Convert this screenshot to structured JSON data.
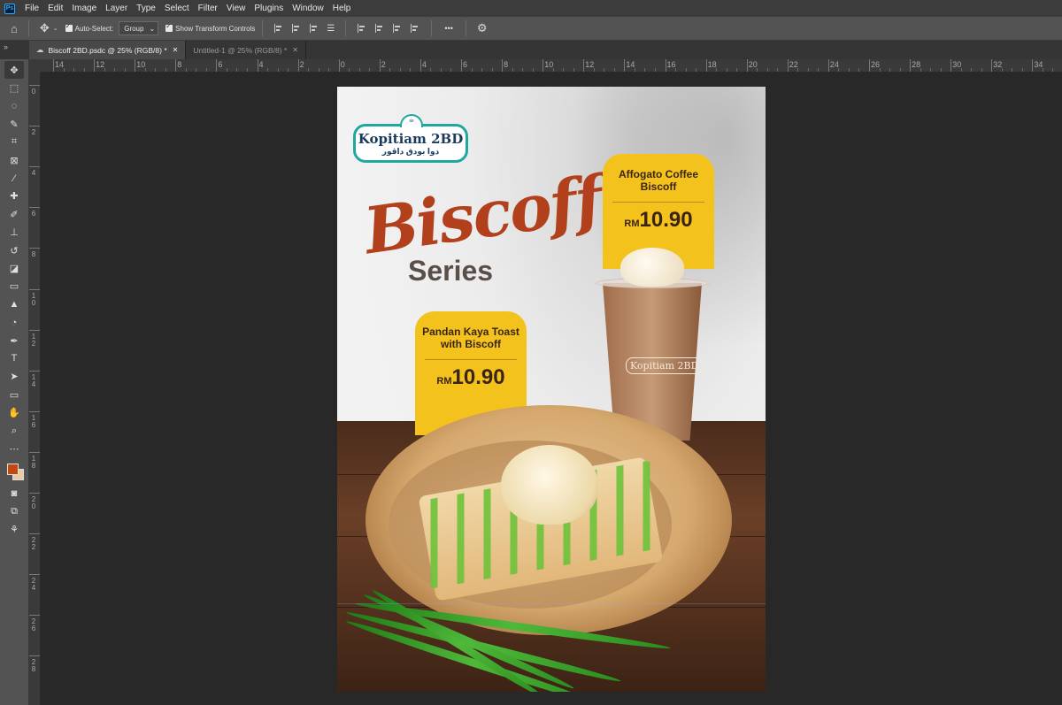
{
  "app": {
    "logo_text": "Ps"
  },
  "menu": [
    "File",
    "Edit",
    "Image",
    "Layer",
    "Type",
    "Select",
    "Filter",
    "View",
    "Plugins",
    "Window",
    "Help"
  ],
  "options": {
    "auto_select_label": "Auto-Select:",
    "auto_select_value": "Group",
    "show_transform_label": "Show Transform Controls",
    "more_label": "•••"
  },
  "tabs": [
    {
      "label": "Biscoff 2BD.psdc @ 25% (RGB/8) *",
      "active": true
    },
    {
      "label": "Untitled-1 @ 25% (RGB/8) *",
      "active": false
    }
  ],
  "ruler": {
    "h_labels": [
      "14",
      "12",
      "10",
      "8",
      "6",
      "4",
      "2",
      "0",
      "2",
      "4",
      "6",
      "8",
      "10",
      "12",
      "14",
      "16",
      "18",
      "20",
      "22",
      "24",
      "26",
      "28",
      "30",
      "32",
      "34"
    ],
    "v_labels": [
      "0",
      "2",
      "4",
      "6",
      "8",
      "10",
      "12",
      "14",
      "16",
      "18",
      "20",
      "22",
      "24",
      "26",
      "28"
    ]
  },
  "colors": {
    "foreground": "#c3480f",
    "background": "#e8c9a0"
  },
  "poster": {
    "logo_main": "Kopitiam 2BD",
    "logo_sub": "دوا بودق داڤور",
    "title": "Biscoff",
    "subtitle": "Series",
    "items": [
      {
        "name_line1": "Affogato Coffee",
        "name_line2": "Biscoff",
        "currency": "RM",
        "price": "10.90"
      },
      {
        "name_line1": "Pandan Kaya Toast",
        "name_line2": "with Biscoff",
        "currency": "RM",
        "price": "10.90"
      }
    ],
    "cup_logo": "Kopitiam 2BD"
  }
}
